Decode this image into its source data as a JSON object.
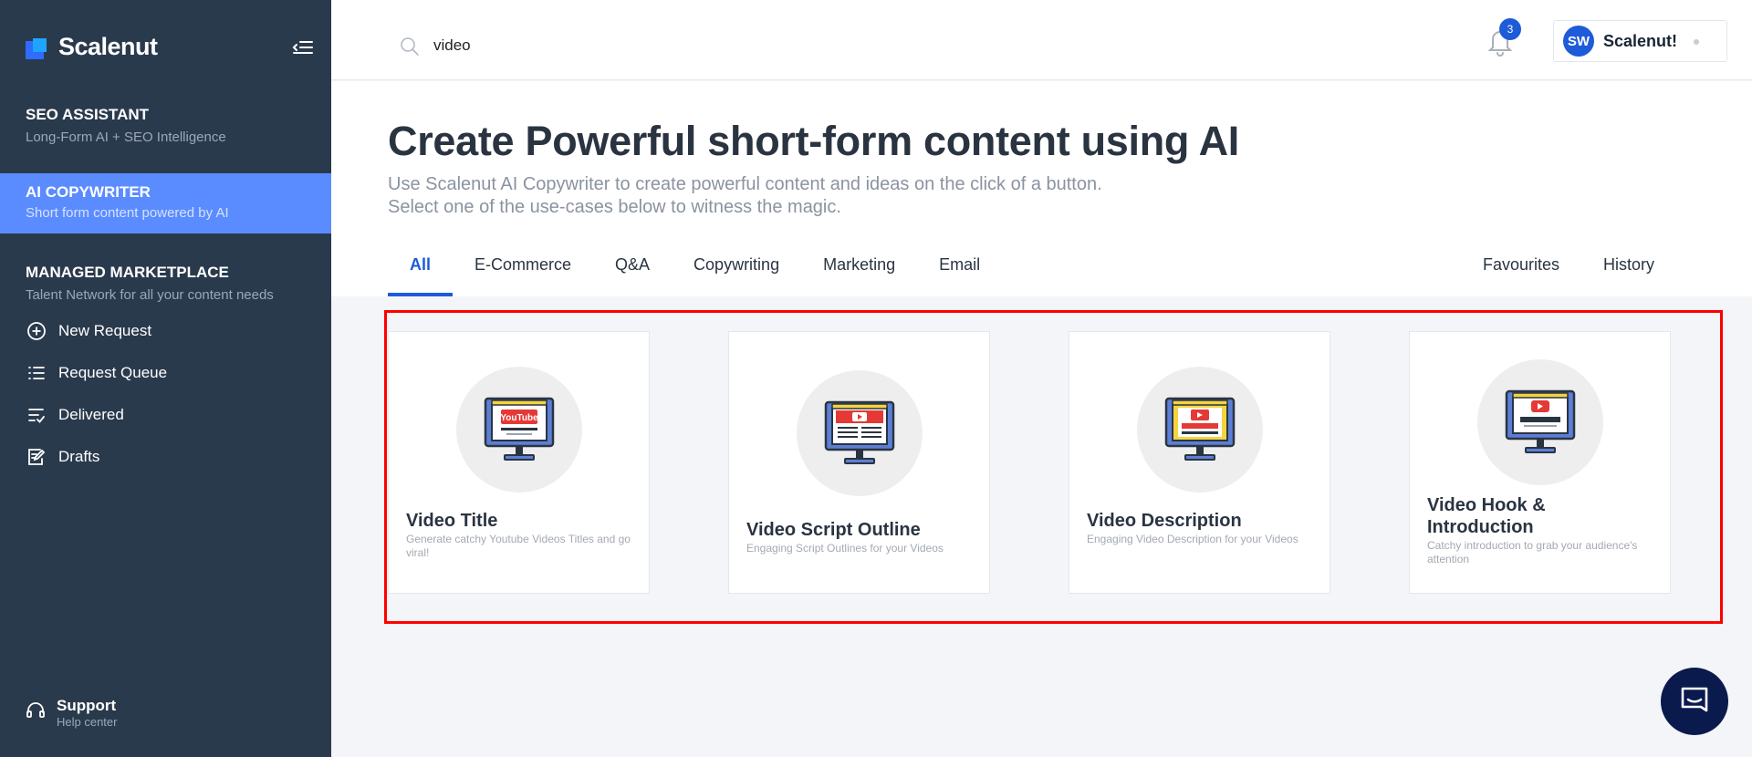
{
  "sidebar": {
    "brand": "Scalenut",
    "sections": {
      "seo": {
        "title": "SEO ASSISTANT",
        "subtitle": "Long-Form AI + SEO Intelligence"
      },
      "ai": {
        "title": "AI COPYWRITER",
        "subtitle": "Short form content powered by AI"
      },
      "mm": {
        "title": "MANAGED MARKETPLACE",
        "subtitle": "Talent Network for all your content needs"
      }
    },
    "items": [
      {
        "label": "New Request",
        "icon": "plus-circle-icon"
      },
      {
        "label": "Request Queue",
        "icon": "list-icon"
      },
      {
        "label": "Delivered",
        "icon": "checklist-icon"
      },
      {
        "label": "Drafts",
        "icon": "edit-document-icon"
      }
    ],
    "support": {
      "title": "Support",
      "subtitle": "Help center"
    }
  },
  "topbar": {
    "search_value": "video",
    "notification_count": "3",
    "avatar_initials": "SW",
    "profile_name": "Scalenut!"
  },
  "header": {
    "title": "Create Powerful short-form content using AI",
    "subtitle_line1": "Use Scalenut AI Copywriter to create powerful content and ideas on the click of a button.",
    "subtitle_line2": "Select one of the use-cases below to witness the magic."
  },
  "tabs": {
    "left": [
      "All",
      "E-Commerce",
      "Q&A",
      "Copywriting",
      "Marketing",
      "Email"
    ],
    "right": [
      "Favourites",
      "History"
    ],
    "active": "All"
  },
  "cards": [
    {
      "title": "Video Title",
      "description": "Generate catchy Youtube Videos Titles and go viral!"
    },
    {
      "title": "Video Script Outline",
      "description": "Engaging Script Outlines for your Videos"
    },
    {
      "title": "Video Description",
      "description": "Engaging Video Description for your Videos"
    },
    {
      "title": "Video Hook & Introduction",
      "description": "Catchy introduction to grab your audience's attention"
    }
  ],
  "colors": {
    "sidebar_bg": "#2a3a4d",
    "sidebar_active": "#5b8cff",
    "accent": "#1e5bd9",
    "highlight_frame": "#ff0000"
  }
}
